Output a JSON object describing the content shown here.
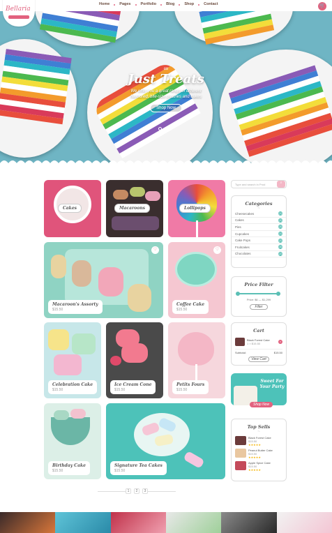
{
  "header": {
    "logo_text": "Bellaria",
    "nav": [
      "Home",
      "Pages",
      "Portfolio",
      "Blog",
      "Shop",
      "Contact"
    ]
  },
  "hero": {
    "title": "Just Treats",
    "subtitle": "We offer you a great range of different flavoured, bite-size pastries and cakes",
    "button": "Shop Now"
  },
  "categories_tiles": [
    {
      "label": "Cakes",
      "color": "#e0547b"
    },
    {
      "label": "Macaroons",
      "color": "#3a2e2e"
    },
    {
      "label": "Lollipops",
      "color": "#f07aa6"
    }
  ],
  "products": [
    {
      "name": "Macaroon's Assorty",
      "price": "$15.50"
    },
    {
      "name": "Coffee Cake",
      "price": "$15.50"
    },
    {
      "name": "Celebration Cake",
      "price": "$15.50"
    },
    {
      "name": "Ice Cream Cone",
      "price": "$15.50"
    },
    {
      "name": "Petits Fours",
      "price": "$15.50"
    },
    {
      "name": "Birthday Cake",
      "price": "$15.50"
    },
    {
      "name": "Signature Tea Cakes",
      "price": "$15.50"
    }
  ],
  "sidebar": {
    "search_placeholder": "Type and search in Prod",
    "categories_title": "Categories",
    "categories": [
      {
        "name": "Cheesecakes",
        "count": "(1)"
      },
      {
        "name": "Cakes",
        "count": "(2)"
      },
      {
        "name": "Pies",
        "count": "(3)"
      },
      {
        "name": "Cupcakes",
        "count": "(1)"
      },
      {
        "name": "Cake Pops",
        "count": "(2)"
      },
      {
        "name": "Fruitcakes",
        "count": "(3)"
      },
      {
        "name": "Chocolates",
        "count": "(2)"
      }
    ],
    "price_title": "Price Filter",
    "price_range": "Price: $6 — $1,299",
    "filter_button": "Filter",
    "cart_title": "Cart",
    "cart_item": "Black Forest Cake",
    "cart_item_qty": "1 × $15.50",
    "cart_subtotal_label": "Subtotal:",
    "cart_subtotal": "$15.50",
    "view_cart": "View Cart",
    "promo_text": "Sweet For Your Party",
    "promo_button": "Shop Now",
    "top_title": "Top Sells",
    "top_items": [
      {
        "name": "Black Forest Cake",
        "price": "$15.50"
      },
      {
        "name": "Peanut Butter Cake",
        "price": "$15.50"
      },
      {
        "name": "Apple Spice Cake",
        "price": "$15.50"
      }
    ],
    "stars": "★★★★★"
  },
  "pagination": [
    "1",
    "2",
    "3"
  ],
  "colors": {
    "accent": "#e2627f",
    "teal": "#5bbfb5"
  }
}
